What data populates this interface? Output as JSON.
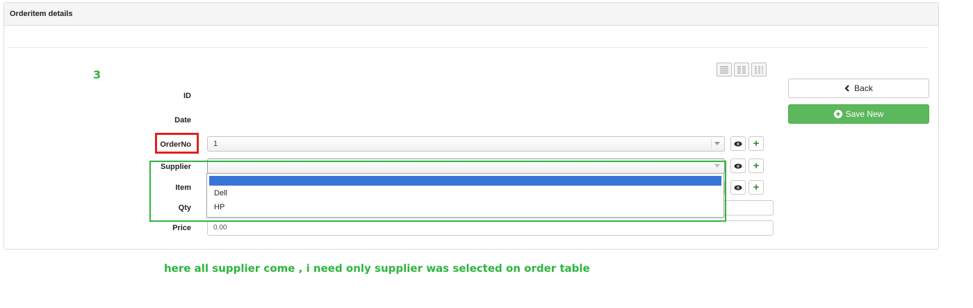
{
  "panel": {
    "title": "Orderitem details"
  },
  "annotation_number": "3",
  "form": {
    "labels": {
      "id": "ID",
      "date": "Date",
      "order_no": "OrderNo",
      "supplier": "Supplier",
      "item": "Item",
      "qty": "Qty",
      "price": "Price"
    },
    "order_no_value": "1",
    "supplier_value": "",
    "price_value": "0.00",
    "supplier_options": [
      "",
      "Dell",
      "HP"
    ]
  },
  "buttons": {
    "back": "Back",
    "save_new": "Save New"
  },
  "icons": {
    "view": "eye-icon",
    "add": "plus-icon",
    "back": "chevron-left-icon",
    "save": "plus-circle-icon"
  },
  "colors": {
    "annotation_green": "#2db53d",
    "annotation_red": "#e0201f",
    "save_button": "#5cb85c",
    "highlight": "#3875d7"
  },
  "caption": "here all supplier come , i need only supplier was selected on order table"
}
